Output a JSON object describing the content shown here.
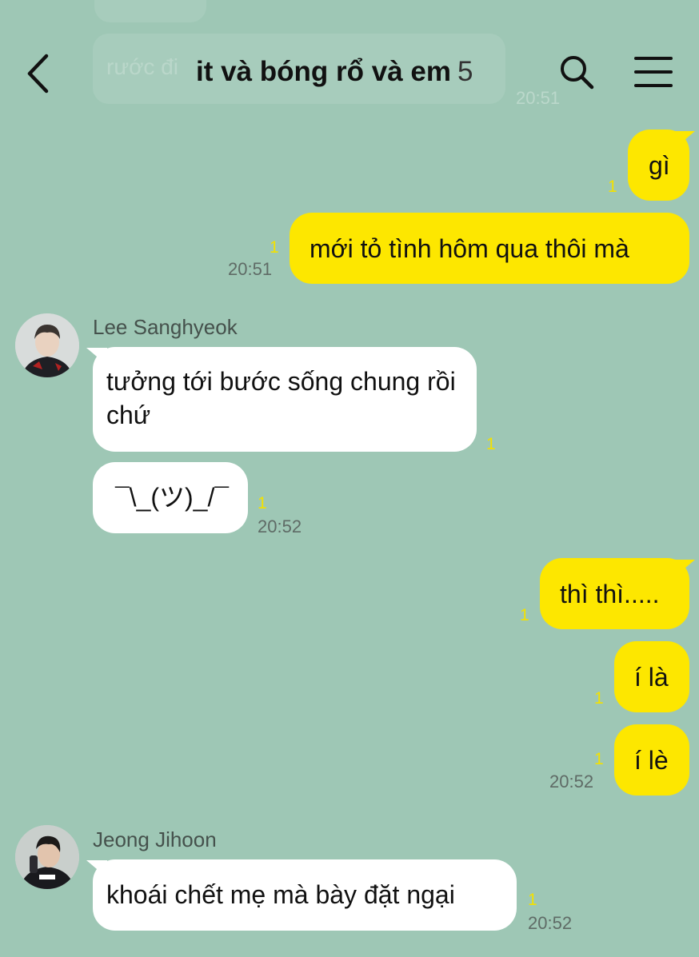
{
  "header": {
    "title": "it và bóng rổ và em",
    "member_count": "5",
    "back_icon": "chevron-left-icon",
    "search_icon": "search-icon",
    "menu_icon": "hamburger-menu-icon"
  },
  "background_ghost": {
    "text": "rước đi",
    "time": "20:51"
  },
  "colors": {
    "background": "#9ec7b5",
    "my_bubble": "#fde700",
    "their_bubble": "#ffffff",
    "unread": "#f3e100"
  },
  "messages": [
    {
      "side": "me",
      "text": "gì",
      "unread": "1",
      "time": ""
    },
    {
      "side": "me",
      "text": "mới tỏ tình hôm qua thôi mà",
      "unread": "1",
      "time": "20:51"
    },
    {
      "side": "them",
      "sender": "Lee Sanghyeok",
      "text": "tưởng tới bước sống chung rồi chứ",
      "unread": "1",
      "time": ""
    },
    {
      "side": "them",
      "text": "¯\\_(ツ)_/¯",
      "unread": "1",
      "time": "20:52"
    },
    {
      "side": "me",
      "text": "thì thì.....",
      "unread": "1",
      "time": ""
    },
    {
      "side": "me",
      "text": "í là",
      "unread": "1",
      "time": ""
    },
    {
      "side": "me",
      "text": "í lè",
      "unread": "1",
      "time": "20:52"
    },
    {
      "side": "them",
      "sender": "Jeong Jihoon",
      "text": "khoái chết mẹ mà bày đặt ngại",
      "unread": "1",
      "time": "20:52"
    }
  ]
}
